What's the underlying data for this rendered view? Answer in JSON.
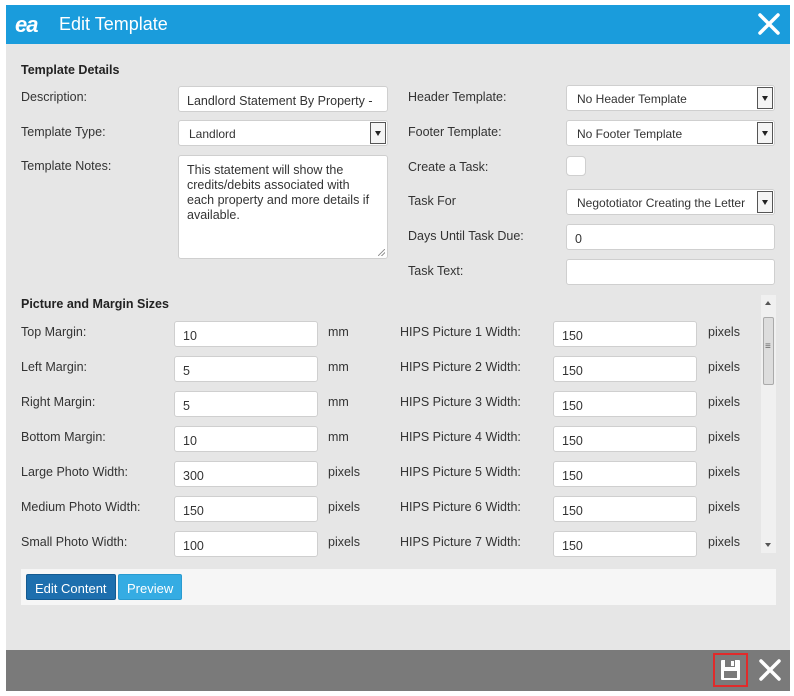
{
  "titlebar": {
    "logo": "ea",
    "title": "Edit Template"
  },
  "details": {
    "section_title": "Template Details",
    "description_label": "Description:",
    "description_value": "Landlord Statement By Property - ",
    "type_label": "Template Type:",
    "type_value": "Landlord",
    "notes_label": "Template Notes:",
    "notes_value": "This statement will show the credits/debits associated with each property and more details if available.",
    "header_label": "Header Template:",
    "header_value": "No Header Template",
    "footer_label": "Footer Template:",
    "footer_value": "No Footer Template",
    "task_label": "Create a Task:",
    "task_for_label": "Task For",
    "task_for_value": "Negototiator Creating the Letter",
    "days_label": "Days Until Task Due:",
    "days_value": "0",
    "task_text_label": "Task Text:",
    "task_text_value": ""
  },
  "sizes": {
    "section_title": "Picture and Margin Sizes",
    "left": [
      {
        "label": "Top Margin:",
        "value": "10",
        "unit": "mm"
      },
      {
        "label": "Left Margin:",
        "value": "5",
        "unit": "mm"
      },
      {
        "label": "Right Margin:",
        "value": "5",
        "unit": "mm"
      },
      {
        "label": "Bottom Margin:",
        "value": "10",
        "unit": "mm"
      },
      {
        "label": "Large Photo Width:",
        "value": "300",
        "unit": "pixels"
      },
      {
        "label": "Medium Photo Width:",
        "value": "150",
        "unit": "pixels"
      },
      {
        "label": "Small Photo Width:",
        "value": "100",
        "unit": "pixels"
      }
    ],
    "right": [
      {
        "label": "HIPS Picture 1 Width:",
        "value": "150",
        "unit": "pixels"
      },
      {
        "label": "HIPS Picture 2 Width:",
        "value": "150",
        "unit": "pixels"
      },
      {
        "label": "HIPS Picture 3 Width:",
        "value": "150",
        "unit": "pixels"
      },
      {
        "label": "HIPS Picture 4 Width:",
        "value": "150",
        "unit": "pixels"
      },
      {
        "label": "HIPS Picture 5 Width:",
        "value": "150",
        "unit": "pixels"
      },
      {
        "label": "HIPS Picture 6 Width:",
        "value": "150",
        "unit": "pixels"
      },
      {
        "label": "HIPS Picture 7 Width:",
        "value": "150",
        "unit": "pixels"
      }
    ]
  },
  "buttons": {
    "edit_content": "Edit Content",
    "preview": "Preview"
  },
  "icons": {
    "close": "close-icon",
    "save": "save-icon",
    "footer_close": "close-icon"
  },
  "colors": {
    "titlebar": "#1a9cdc",
    "footer": "#7a7a7a",
    "save_highlight": "#e02b2b"
  }
}
